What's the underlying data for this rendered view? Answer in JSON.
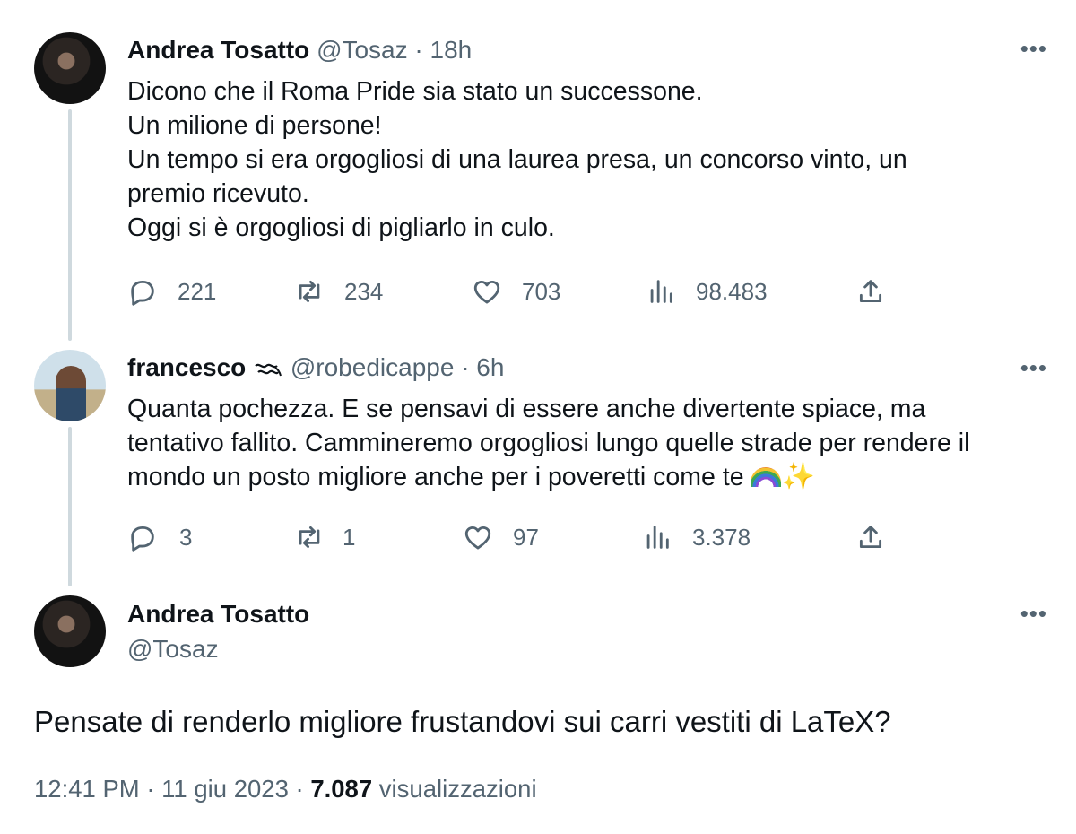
{
  "tweet1": {
    "name": "Andrea Tosatto",
    "handle": "@Tosaz",
    "sep": "·",
    "time": "18h",
    "lines": [
      "Dicono che il Roma Pride sia stato un successone.",
      "Un milione di persone!",
      "Un tempo si era orgogliosi di una laurea presa, un concorso vinto, un",
      "premio ricevuto.",
      "Oggi si è orgogliosi di pigliarlo in culo."
    ],
    "replies": "221",
    "retweets": "234",
    "likes": "703",
    "views": "98.483"
  },
  "tweet2": {
    "name": "francesco",
    "handle": "@robedicappe",
    "sep": "·",
    "time": "6h",
    "lines": [
      "Quanta pochezza. E se pensavi di essere anche divertente spiace, ma",
      "tentativo fallito. Cammineremo orgogliosi lungo quelle strade per rendere il",
      "mondo un posto migliore anche per i poveretti come te"
    ],
    "replies": "3",
    "retweets": "1",
    "likes": "97",
    "views": "3.378"
  },
  "main_tweet": {
    "name": "Andrea Tosatto",
    "handle": "@Tosaz",
    "text": "Pensate di renderlo migliore frustandovi sui carri vestiti di LaTeX?",
    "time": "12:41 PM",
    "sep": "·",
    "date": "11 giu 2023",
    "sep2": "·",
    "views_count": "7.087",
    "views_label": "visualizzazioni"
  },
  "icons": {
    "more": "more-icon",
    "reply": "reply-icon",
    "retweet": "retweet-icon",
    "like": "heart-icon",
    "views": "views-chart-icon",
    "share": "share-icon",
    "wave": "wave-icon",
    "rainbow": "rainbow-emoji",
    "sparkles": "sparkles-emoji"
  },
  "colors": {
    "text": "#0f1419",
    "muted": "#536471",
    "thread_line": "#cfd9de"
  }
}
